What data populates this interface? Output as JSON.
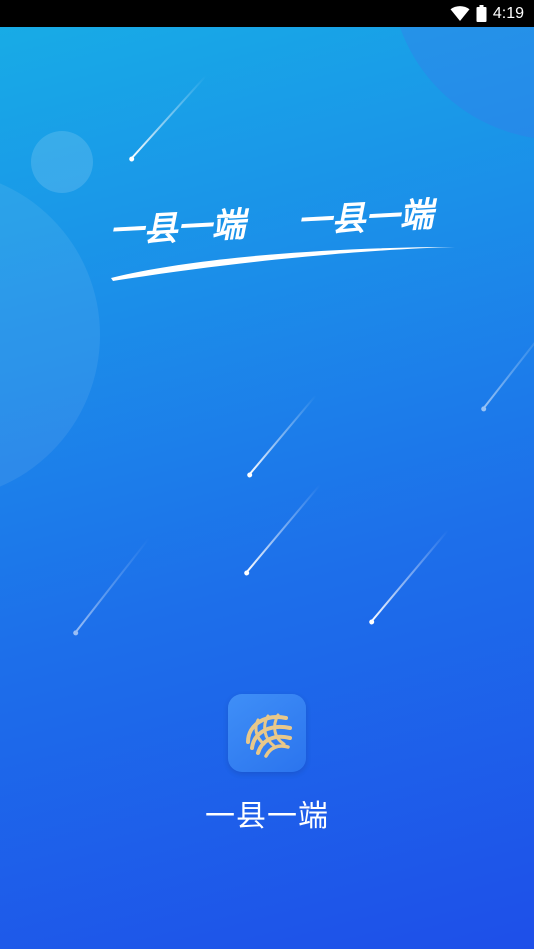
{
  "status_bar": {
    "time": "4:19",
    "wifi_icon": "wifi-icon",
    "battery_icon": "battery-icon"
  },
  "splash": {
    "slogan_left": "一县一端",
    "slogan_right": "一县一端",
    "app_name": "一县一端",
    "logo_icon": "app-logo-icon"
  },
  "colors": {
    "gradient_top": "#17aee6",
    "gradient_bottom": "#1e4fe9",
    "logo_bg": "#3f8ff7",
    "logo_gold": "#e8c88a",
    "text": "#ffffff"
  }
}
